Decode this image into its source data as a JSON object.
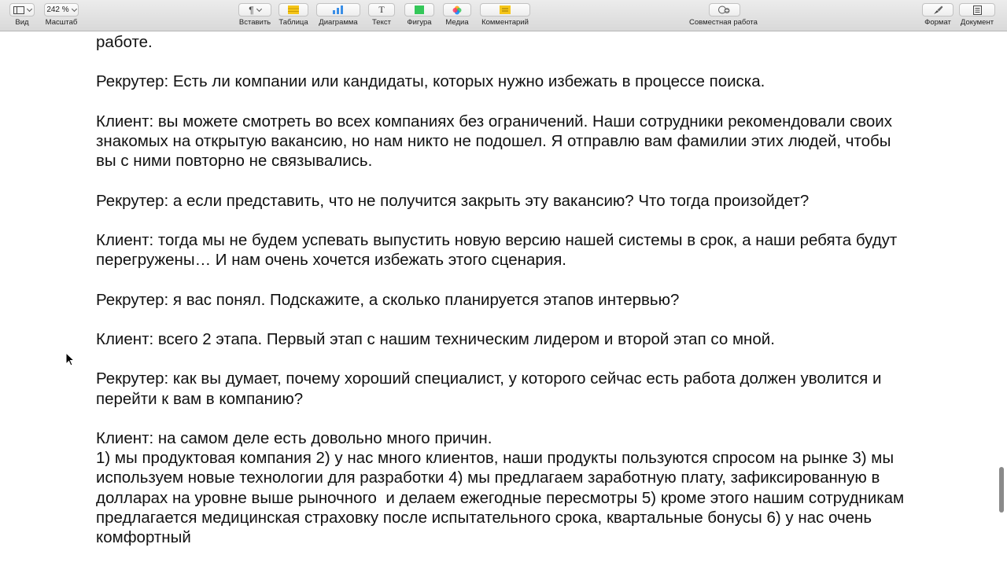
{
  "toolbar": {
    "view_label": "Вид",
    "zoom_value": "242 %",
    "zoom_label": "Масштаб",
    "insert_label": "Вставить",
    "table_label": "Таблица",
    "chart_label": "Диаграмма",
    "text_label": "Текст",
    "shape_label": "Фигура",
    "media_label": "Медиа",
    "comment_label": "Комментарий",
    "collab_label": "Совместная работа",
    "format_label": "Формат",
    "document_label": "Документ",
    "colors": {
      "table": "#f5c518",
      "chart": "#3a8ee6",
      "shape": "#34c759",
      "comment": "#f5c518"
    }
  },
  "document": {
    "paragraphs": [
      "работе.",
      "Рекрутер: Есть ли компании или кандидаты, которых нужно избежать в процессе поиска.",
      "Клиент: вы можете смотреть во всех компаниях без ограничений. Наши сотрудники рекомендовали своих знакомых на открытую вакансию, но нам никто не подошел. Я отправлю вам фамилии этих людей, чтобы вы с ними повторно не связывались.",
      "Рекрутер: а если представить, что не получится закрыть эту вакансию? Что тогда произойдет?",
      "Клиент: тогда мы не будем успевать выпустить новую версию нашей системы в срок, а наши ребята будут перегружены… И нам очень хочется избежать этого сценария.",
      "Рекрутер: я вас понял. Подскажите, а сколько планируется этапов интервью?",
      "Клиент: всего 2 этапа. Первый этап с нашим техническим лидером и второй этап со мной.",
      "Рекрутер: как вы думает, почему хороший специалист, у которого сейчас есть работа должен уволится и перейти к вам в компанию?",
      "Клиент: на самом деле есть довольно много причин.",
      "1) мы продуктовая компания 2) у нас много клиентов, наши продукты пользуются спросом на рынке 3) мы используем новые технологии для разработки 4) мы предлагаем заработную плату, зафиксированную в долларах на уровне выше рыночного  и делаем ежегодные пересмотры 5) кроме этого нашим сотрудникам предлагается медицинская страховку после испытательного срока, квартальные бонусы 6) у нас очень комфортный"
    ]
  }
}
